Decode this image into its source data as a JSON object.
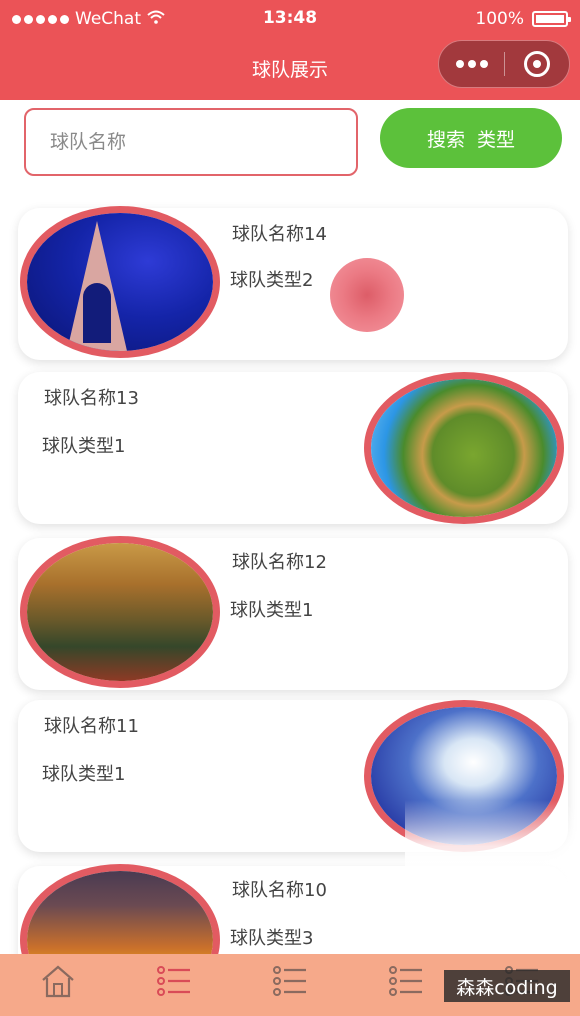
{
  "status_bar": {
    "carrier": "WeChat",
    "time": "13:48",
    "battery": "100%"
  },
  "nav": {
    "title": "球队展示"
  },
  "search": {
    "placeholder": "球队名称",
    "button_label_1": "搜索",
    "button_label_2": "类型"
  },
  "teams": [
    {
      "name": "球队名称14",
      "type": "球队类型2",
      "image": "eiffel-tower-night",
      "image_side": "left"
    },
    {
      "name": "球队名称13",
      "type": "球队类型1",
      "image": "tiny-planet-landscape",
      "image_side": "right"
    },
    {
      "name": "球队名称12",
      "type": "球队类型1",
      "image": "mountain-valley-sunset",
      "image_side": "left"
    },
    {
      "name": "球队名称11",
      "type": "球队类型1",
      "image": "blue-sky-clouds",
      "image_side": "right"
    },
    {
      "name": "球队名称10",
      "type": "球队类型3",
      "image": "sunset-sky",
      "image_side": "left"
    }
  ],
  "tabbar": {
    "items": [
      "home-icon",
      "list-icon",
      "list-icon",
      "list-icon",
      "list-icon"
    ]
  },
  "watermark": "森森coding",
  "colors": {
    "primary": "#eb5357",
    "accent_green": "#5cc13b",
    "tabbar": "#f6a98a"
  }
}
